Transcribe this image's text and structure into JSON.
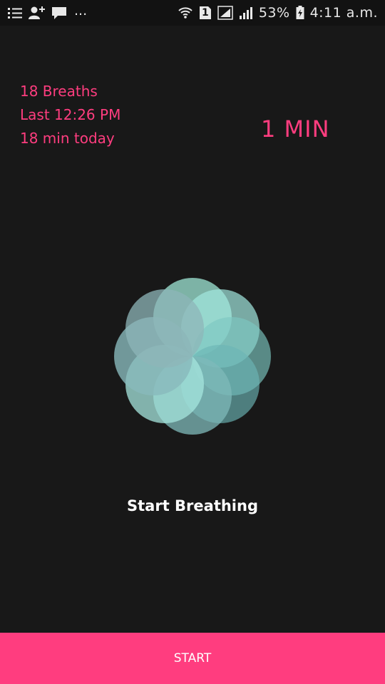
{
  "status_bar": {
    "battery_percent": "53%",
    "time": "4:11 a.m.",
    "sim_number": "1",
    "ellipsis": "...",
    "icons": [
      "list-icon",
      "add-contact-icon",
      "chat-icon",
      "wifi-icon",
      "sim-icon",
      "signal-icon",
      "signal-icon",
      "battery-icon"
    ]
  },
  "stats": {
    "breaths": "18 Breaths",
    "last": "Last 12:26 PM",
    "today": "18 min today"
  },
  "duration": "1 MIN",
  "start_label": "Start Breathing",
  "start_button": "START",
  "colors": {
    "accent": "#ff3d7f",
    "background": "#181818",
    "flower": "#7fd0c4"
  }
}
